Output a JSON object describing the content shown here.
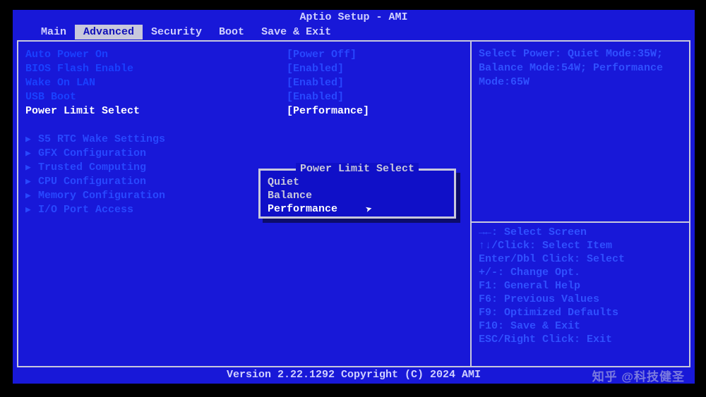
{
  "title": "Aptio Setup - AMI",
  "menubar": {
    "items": [
      "Main",
      "Advanced",
      "Security",
      "Boot",
      "Save & Exit"
    ],
    "active_index": 1
  },
  "settings": [
    {
      "label": "Auto Power On",
      "value": "[Power Off]",
      "selected": false
    },
    {
      "label": "BIOS Flash Enable",
      "value": "[Enabled]",
      "selected": false
    },
    {
      "label": "Wake On LAN",
      "value": "[Enabled]",
      "selected": false
    },
    {
      "label": "USB Boot",
      "value": "[Enabled]",
      "selected": false
    },
    {
      "label": "Power Limit Select",
      "value": "[Performance]",
      "selected": true
    }
  ],
  "submenus": [
    "S5 RTC Wake Settings",
    "GFX Configuration",
    "Trusted Computing",
    "CPU Configuration",
    "Memory Configuration",
    "I/O Port Access"
  ],
  "help": {
    "line1": "Select Power: Quiet Mode:35W;",
    "line2": "Balance Mode:54W; Performance",
    "line3": "Mode:65W"
  },
  "keybinds": [
    "→←: Select Screen",
    "↑↓/Click: Select Item",
    "Enter/Dbl Click: Select",
    "+/-: Change Opt.",
    "F1: General Help",
    "F6: Previous Values",
    "F9: Optimized Defaults",
    "F10: Save & Exit",
    "ESC/Right Click: Exit"
  ],
  "popup": {
    "title": "Power Limit Select",
    "items": [
      "Quiet",
      "Balance",
      "Performance"
    ],
    "selected_index": 2
  },
  "footer": "Version 2.22.1292 Copyright (C) 2024 AMI",
  "watermark": "知乎 @科技健圣"
}
